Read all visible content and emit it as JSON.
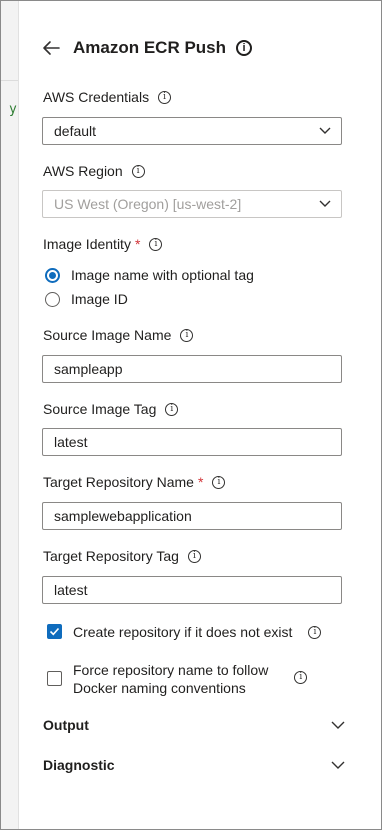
{
  "header": {
    "title": "Amazon ECR Push"
  },
  "editor_glyph": "y",
  "fields": {
    "aws_credentials": {
      "label": "AWS Credentials",
      "value": "default"
    },
    "aws_region": {
      "label": "AWS Region",
      "value": "US West (Oregon) [us-west-2]"
    },
    "image_identity": {
      "label": "Image Identity",
      "required_mark": "*",
      "options": [
        {
          "label": "Image name with optional tag",
          "selected": true
        },
        {
          "label": "Image ID",
          "selected": false
        }
      ]
    },
    "source_image_name": {
      "label": "Source Image Name",
      "value": "sampleapp"
    },
    "source_image_tag": {
      "label": "Source Image Tag",
      "value": "latest"
    },
    "target_repository_name": {
      "label": "Target Repository Name",
      "required_mark": "*",
      "value": "samplewebapplication"
    },
    "target_repository_tag": {
      "label": "Target Repository Tag",
      "value": "latest"
    }
  },
  "checkboxes": {
    "create_repo": {
      "label": "Create repository if it does not exist",
      "checked": true
    },
    "force_name": {
      "line1": "Force repository name to follow",
      "line2": "Docker naming conventions",
      "checked": false
    }
  },
  "sections": {
    "output": {
      "label": "Output"
    },
    "diagnostic": {
      "label": "Diagnostic"
    }
  },
  "colors": {
    "accent": "#0f6cbd",
    "required": "#d13438",
    "text": "#201f1e",
    "disabled_text": "#a19f9d"
  },
  "icons": [
    "back-arrow-icon",
    "info-icon",
    "chevron-down-icon",
    "checkmark-icon"
  ]
}
